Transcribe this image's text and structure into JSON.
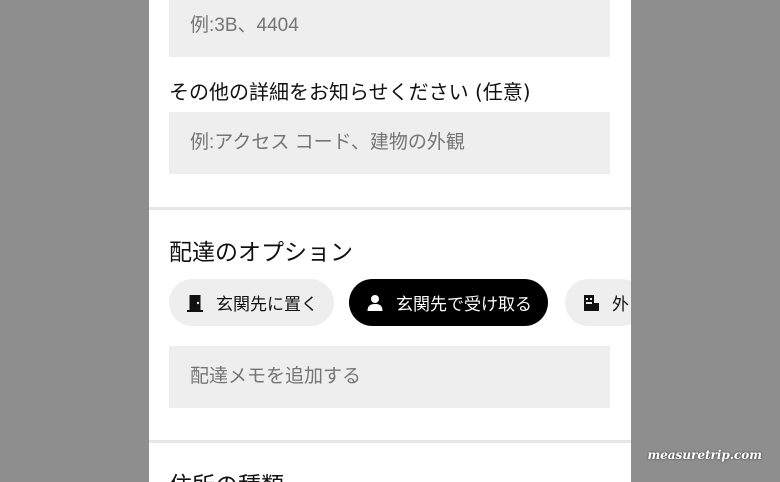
{
  "form": {
    "unit_placeholder": "例:3B、4404",
    "details_label": "その他の詳細をお知らせください (任意)",
    "details_placeholder": "例:アクセス コード、建物の外観",
    "delivery_title": "配達のオプション",
    "delivery_options": [
      {
        "label": "玄関先に置く",
        "icon": "door-icon",
        "selected": false
      },
      {
        "label": "玄関先で受け取る",
        "icon": "person-icon",
        "selected": true
      },
      {
        "label": "外",
        "icon": "building-icon",
        "selected": false
      }
    ],
    "note_placeholder": "配達メモを追加する",
    "address_type_title": "住所の種類"
  },
  "watermark": "measuretrip.com",
  "colors": {
    "backdrop": "#8e8e8e",
    "panel": "#ffffff",
    "field_bg": "#eeeeee",
    "chip_selected_bg": "#000000",
    "chip_selected_text": "#ffffff"
  }
}
